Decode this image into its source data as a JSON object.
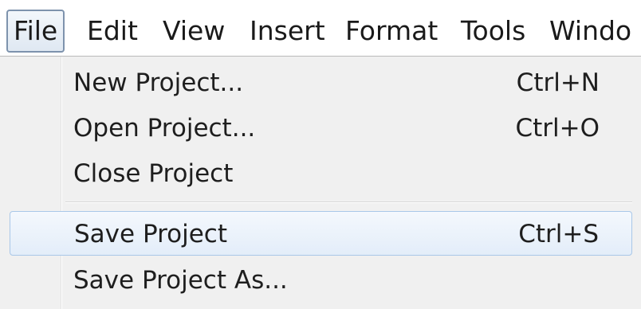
{
  "menubar": {
    "items": [
      {
        "label": "File",
        "active": true
      },
      {
        "label": "Edit"
      },
      {
        "label": "View"
      },
      {
        "label": "Insert"
      },
      {
        "label": "Format"
      },
      {
        "label": "Tools"
      },
      {
        "label": "Windo"
      }
    ]
  },
  "file_menu": {
    "items": [
      {
        "label": "New Project...",
        "shortcut": "Ctrl+N"
      },
      {
        "label": "Open Project...",
        "shortcut": "Ctrl+O"
      },
      {
        "label": "Close Project",
        "shortcut": ""
      },
      {
        "label": "Save Project",
        "shortcut": "Ctrl+S",
        "highlighted": true
      },
      {
        "label": "Save Project As...",
        "shortcut": ""
      }
    ]
  }
}
